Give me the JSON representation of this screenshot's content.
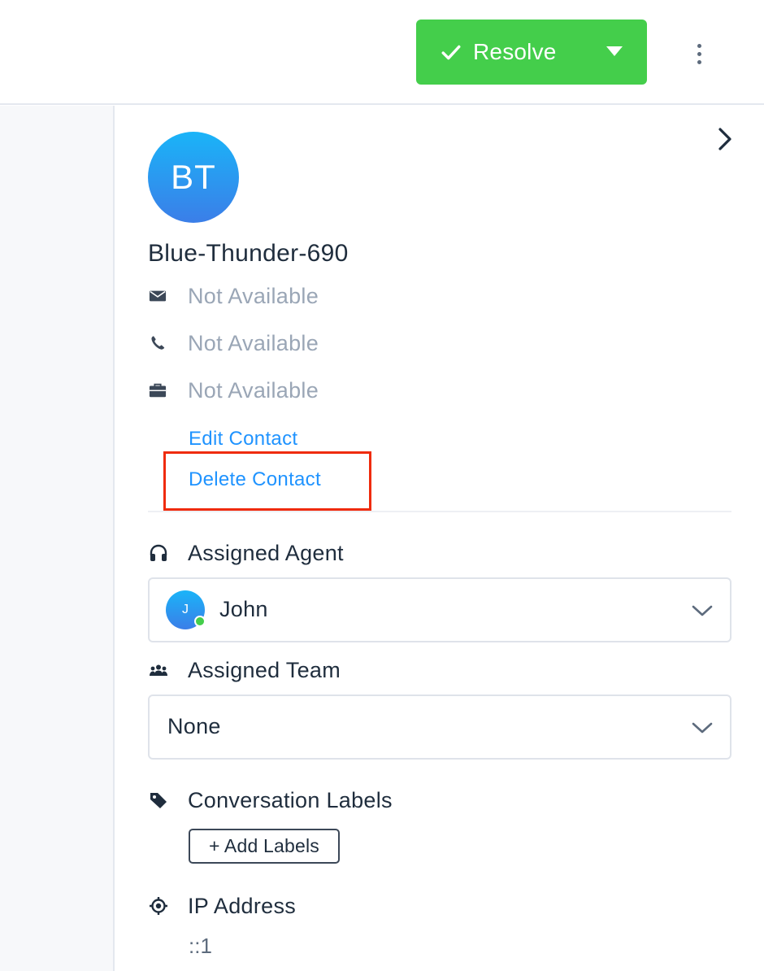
{
  "header": {
    "resolve_label": "Resolve",
    "colors": {
      "resolve_bg": "#44ce4b",
      "link": "#1f93ff",
      "highlight": "#ef2b0c"
    }
  },
  "contact": {
    "initials": "BT",
    "name": "Blue-Thunder-690",
    "email": "Not Available",
    "phone": "Not Available",
    "company": "Not Available",
    "edit_label": "Edit Contact",
    "delete_label": "Delete Contact"
  },
  "assigned_agent": {
    "title": "Assigned Agent",
    "agent_initial": "J",
    "agent_name": "John",
    "status": "online"
  },
  "assigned_team": {
    "title": "Assigned Team",
    "value": "None"
  },
  "labels": {
    "title": "Conversation Labels",
    "add_label": "+ Add Labels"
  },
  "ip": {
    "title": "IP Address",
    "value": "::1"
  },
  "icons": {
    "resolve": "check-icon",
    "dropdown": "caret-down-icon",
    "more": "more-vertical-icon",
    "collapse": "chevron-right-icon",
    "email": "mail-icon",
    "phone": "phone-icon",
    "company": "briefcase-icon",
    "agent": "headset-icon",
    "team": "people-icon",
    "labels": "tag-icon",
    "ip": "location-target-icon"
  }
}
